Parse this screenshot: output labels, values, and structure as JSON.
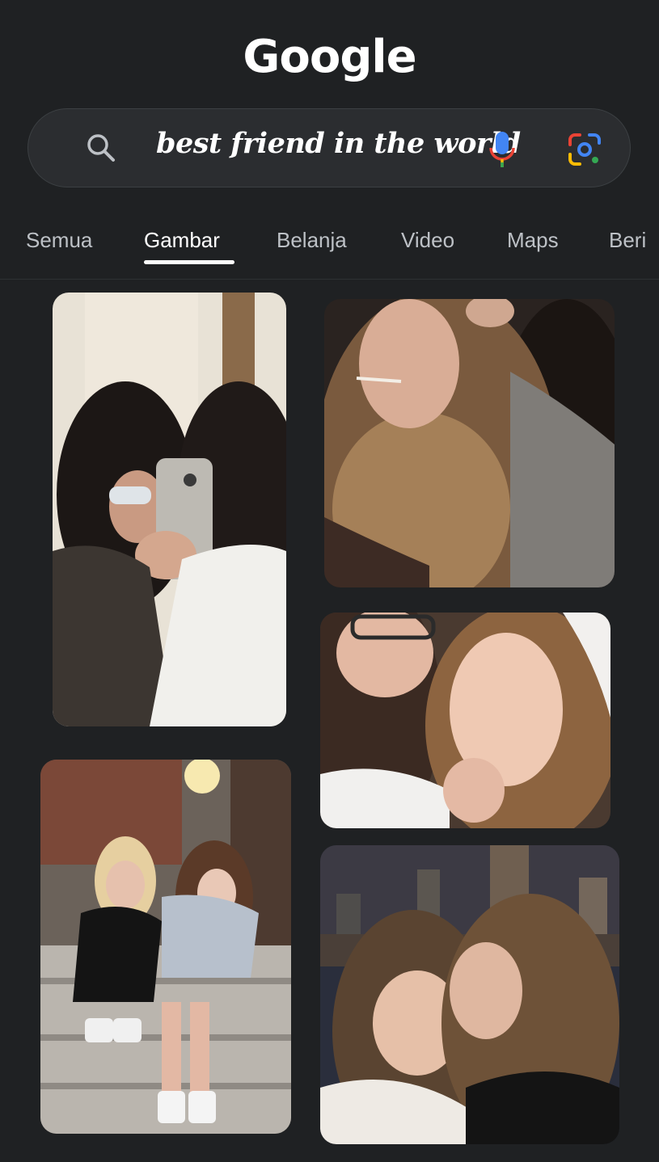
{
  "logo": {
    "text": "Google"
  },
  "search": {
    "query": "best friend in the world",
    "icons": [
      "search-icon",
      "mic-icon",
      "lens-icon"
    ]
  },
  "tabs": [
    {
      "label": "Semua"
    },
    {
      "label": "Gambar",
      "active": true
    },
    {
      "label": "Belanja"
    },
    {
      "label": "Video"
    },
    {
      "label": "Maps"
    },
    {
      "label": "Beri"
    }
  ],
  "results": [
    {
      "subject": "two friends taking a mirror selfie with a phone"
    },
    {
      "subject": "two friends with long wavy hair close-up selfie"
    },
    {
      "subject": "two friends with freckles close-up selfie"
    },
    {
      "subject": "two friends sitting on outdoor steps"
    },
    {
      "subject": "two friends hugging with city skyline at night"
    }
  ],
  "colors": {
    "background": "#1f2123",
    "searchbar": "#2b2d30",
    "tab_inactive": "#bdc1c6",
    "tab_active": "#ffffff"
  }
}
